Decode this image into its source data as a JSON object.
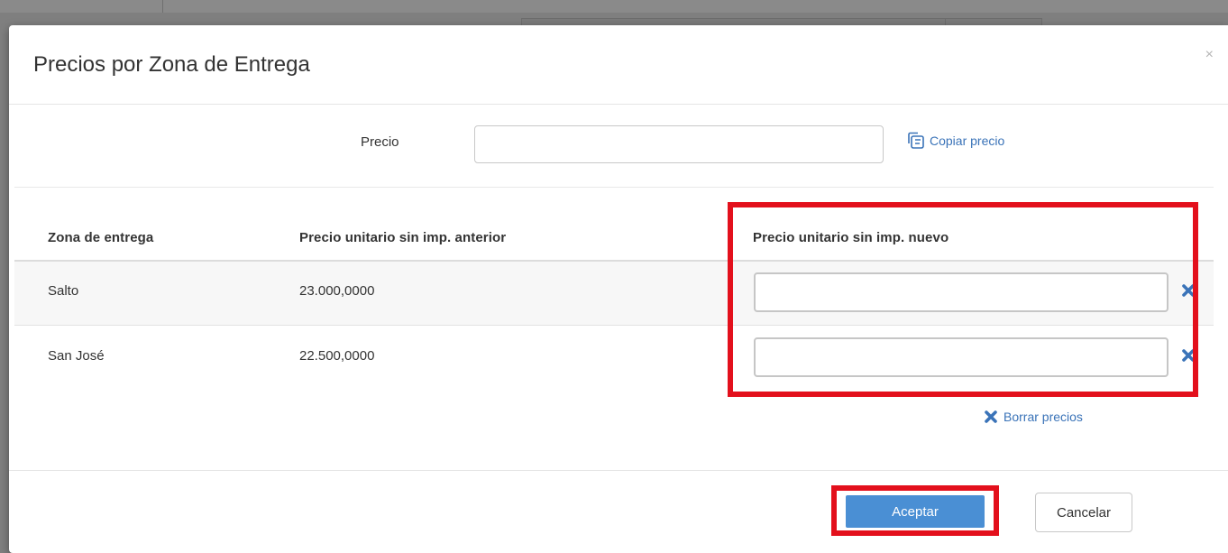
{
  "modal": {
    "title": "Precios por Zona de Entrega",
    "close_label": "×"
  },
  "precio": {
    "label": "Precio",
    "value": "",
    "placeholder": "",
    "copy_link": "Copiar precio"
  },
  "table": {
    "headers": [
      "Zona de entrega",
      "Precio unitario sin imp. anterior",
      "Precio unitario sin imp. nuevo"
    ],
    "rows": [
      {
        "zona": "Salto",
        "anterior": "23.000,0000",
        "nuevo": ""
      },
      {
        "zona": "San José",
        "anterior": "22.500,0000",
        "nuevo": ""
      }
    ]
  },
  "borrar_link": "Borrar precios",
  "footer": {
    "accept_label": "Aceptar",
    "cancel_label": "Cancelar"
  },
  "colors": {
    "link": "#3a73b8",
    "primary_button": "#4a8fd4",
    "highlight": "#e3101c"
  },
  "icons": {
    "copy": "copy-icon",
    "clear_row": "times-icon",
    "clear_all": "times-icon",
    "close": "close-icon"
  }
}
